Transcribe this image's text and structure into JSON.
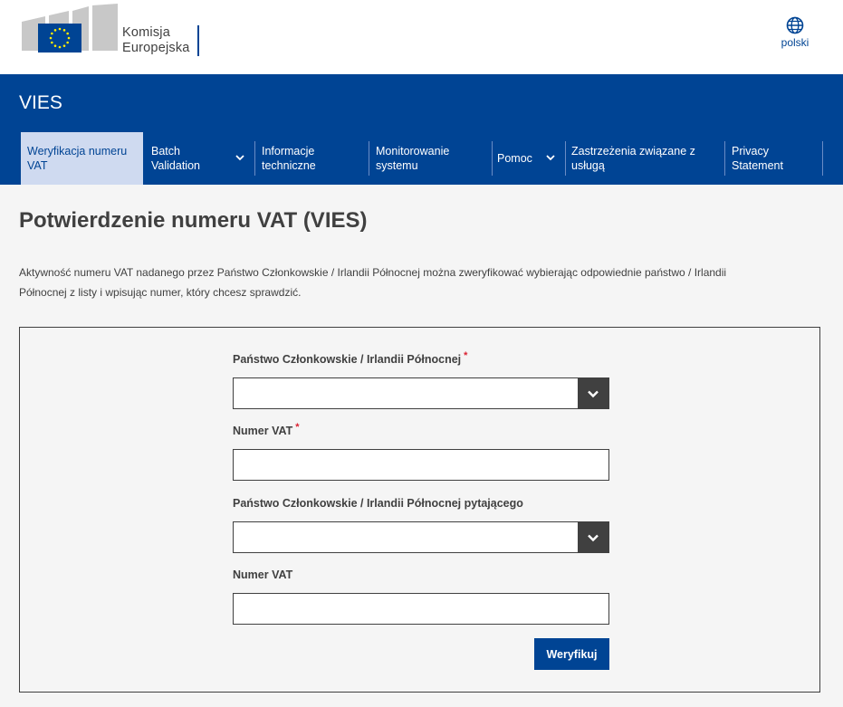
{
  "brand": {
    "org_line1": "Komisja",
    "org_line2": "Europejska",
    "flag_color": "#004494",
    "star_color": "#ffed00"
  },
  "language": {
    "icon": "globe-icon",
    "label": "polski"
  },
  "header": {
    "site_name": "VIES",
    "background": "#004494"
  },
  "nav": {
    "items": [
      {
        "line1": "Weryfikacja numeru",
        "line2": "VAT",
        "active": true
      },
      {
        "line1": "Batch",
        "line2": "Validation",
        "dropdown": true
      },
      {
        "line1": "Informacje",
        "line2": "techniczne"
      },
      {
        "line1": "Monitorowanie",
        "line2": "systemu"
      },
      {
        "line1": "Pomoc",
        "line2": "",
        "dropdown": true
      },
      {
        "line1": "Zastrzeżenia związane z",
        "line2": "usługą"
      },
      {
        "line1": "Privacy",
        "line2": "Statement"
      }
    ]
  },
  "page": {
    "title": "Potwierdzenie numeru VAT (VIES)",
    "intro_line1": "Aktywność numeru VAT nadanego przez Państwo Członkowskie / Irlandii Północnej można zweryfikować wybierając odpowiednie państwo / Irlandii",
    "intro_line2": "Północnej z listy i wpisując numer, który chcesz sprawdzić."
  },
  "form": {
    "member_state_label": "Państwo Członkowskie / Irlandii Północnej",
    "member_state_value": "",
    "vat_number_label": "Numer VAT",
    "vat_number_value": "",
    "requester_state_label": "Państwo Członkowskie / Irlandii Północnej pytającego",
    "requester_state_value": "",
    "requester_vat_label": "Numer VAT",
    "requester_vat_value": "",
    "required_mark": "*",
    "submit_label": "Weryfikuj"
  }
}
